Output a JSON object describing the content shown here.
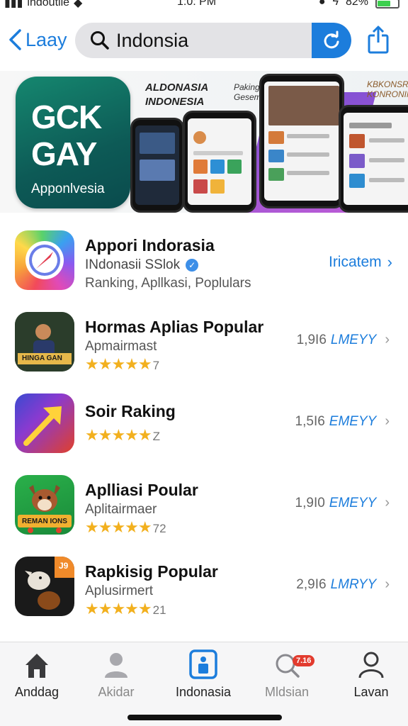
{
  "status_bar": {
    "carrier": "indoutlie",
    "time": "1:0: PM",
    "battery": "82%"
  },
  "nav": {
    "back_label": "Laay",
    "search_value": "Indonsia"
  },
  "banner": {
    "app_icon_line1": "GCK",
    "app_icon_line2": "GAY",
    "app_icon_caption": "Apponlvesia",
    "headline": "ALDONASIA INDONESIA",
    "tagline": "Paking Geseme",
    "side_text": "KBKONSR KONRONIM"
  },
  "featured": {
    "title": "Appori Indorasia",
    "developer": "INdonasii SSlok",
    "description": "Ranking, Apllkasi, Poplulars",
    "action_label": "Iricatem"
  },
  "apps": [
    {
      "title": "Hormas Aplias Popular",
      "subtitle": "Apmairmast",
      "rating_count": "7",
      "count": "1,9I6",
      "label": "LMEYY"
    },
    {
      "title": "Soir Raking",
      "subtitle": "",
      "rating_count": "Z",
      "count": "1,5I6",
      "label": "EMEYY"
    },
    {
      "title": "Aplliasi Poular",
      "subtitle": "Aplitairmaer",
      "rating_count": "72",
      "count": "1,9I0",
      "label": "EMEYY"
    },
    {
      "title": "Rapkisig Popular",
      "subtitle": "Aplusirmert",
      "rating_count": "21",
      "count": "2,9I6",
      "label": "LMRYY"
    }
  ],
  "app_icon_texts": {
    "hormas": "HINGA GAN",
    "aplliasi": "REMAN IONS",
    "rapkisig": "J9"
  },
  "tabs": [
    {
      "label": "Anddag",
      "icon": "home-icon"
    },
    {
      "label": "Akidar",
      "icon": "person-icon"
    },
    {
      "label": "Indonasia",
      "icon": "badge-icon"
    },
    {
      "label": "Mldsian",
      "icon": "search-icon",
      "badge": "7.16"
    },
    {
      "label": "Lavan",
      "icon": "account-icon"
    }
  ],
  "colors": {
    "accent": "#1c7ddc",
    "star": "#f2b01e",
    "badge": "#e23b2e"
  }
}
